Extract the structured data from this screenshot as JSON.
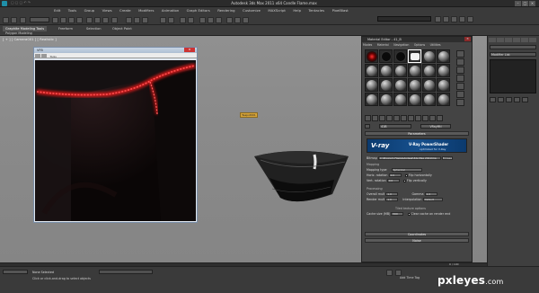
{
  "app": {
    "title": "Autodesk 3ds Max 2011 x64",
    "file": "Candle Flame.max",
    "menu": [
      "Edit",
      "Tools",
      "Group",
      "Views",
      "Create",
      "Modifiers",
      "Animation",
      "Graph Editors",
      "Rendering",
      "Customize",
      "MAXScript",
      "Help",
      "Tentacles",
      "PixelBlast"
    ]
  },
  "ribbon": {
    "tabs": [
      "Graphite Modeling Tools",
      "Freeform",
      "Selection",
      "Object Paint"
    ],
    "subtab": "Polygon Modeling"
  },
  "viewport": {
    "label": "[ + ] [ Camera001 ] [ Realistic ]"
  },
  "vfb": {
    "title": "VFB",
    "menu": "Tools",
    "close": "x"
  },
  "teapot_label": "Teapot001",
  "right_panel": {
    "modifier_list": "Modifier List"
  },
  "material_editor": {
    "title": "Material Editor - 41_B",
    "menu": [
      "Modes",
      "Material",
      "Navigation",
      "Options",
      "Utilities"
    ],
    "mat_name": "41B",
    "type_button": "VRayMtl",
    "parameters_header": "Parameters",
    "banner": {
      "logo": "V-ray",
      "title": "V-Ray PowerShader",
      "subtitle": "optimized for V-Ray"
    },
    "bitmap_label": "Bitmap",
    "bitmap_path": "C:\\Program Files\\Autodesk\\3ds Max 2011\\ma",
    "browse": "Browse",
    "mapping_header": "Mapping",
    "mapping_type_label": "Mapping type",
    "mapping_type_value": "Spherical",
    "horiz_rotation_label": "Horiz. rotation",
    "horiz_rotation_value": "0.0",
    "flip_h": "Flip horizontally",
    "vert_rotation_label": "Vert. rotation",
    "vert_rotation_value": "0.0",
    "flip_v": "Flip vertically",
    "processing_header": "Processing",
    "overall_mult_label": "Overall mult",
    "overall_mult_value": "1.0",
    "gamma_label": "Gamma",
    "gamma_value": "1.0",
    "render_mult_label": "Render mult",
    "render_mult_value": "1.0",
    "interpolation_label": "Interpolation",
    "interpolation_value": "Default",
    "texture_header": "Tiled texture options",
    "cache_label": "Cache size (MB)",
    "cache_value": "500",
    "clear_cache": "Clear cache on render end",
    "coordinates_header": "Coordinates",
    "noise_header": "Noise"
  },
  "status": {
    "selected": "None Selected",
    "prompt": "Click or click-and-drag to select objects",
    "frame": "0 / 100",
    "add_time_tag": "Add Time Tag"
  },
  "watermark": {
    "brand": "pxleyes",
    "domain": ".com"
  },
  "colors": {
    "led": "#ff1a1a",
    "vray_blue": "#164f8c"
  }
}
